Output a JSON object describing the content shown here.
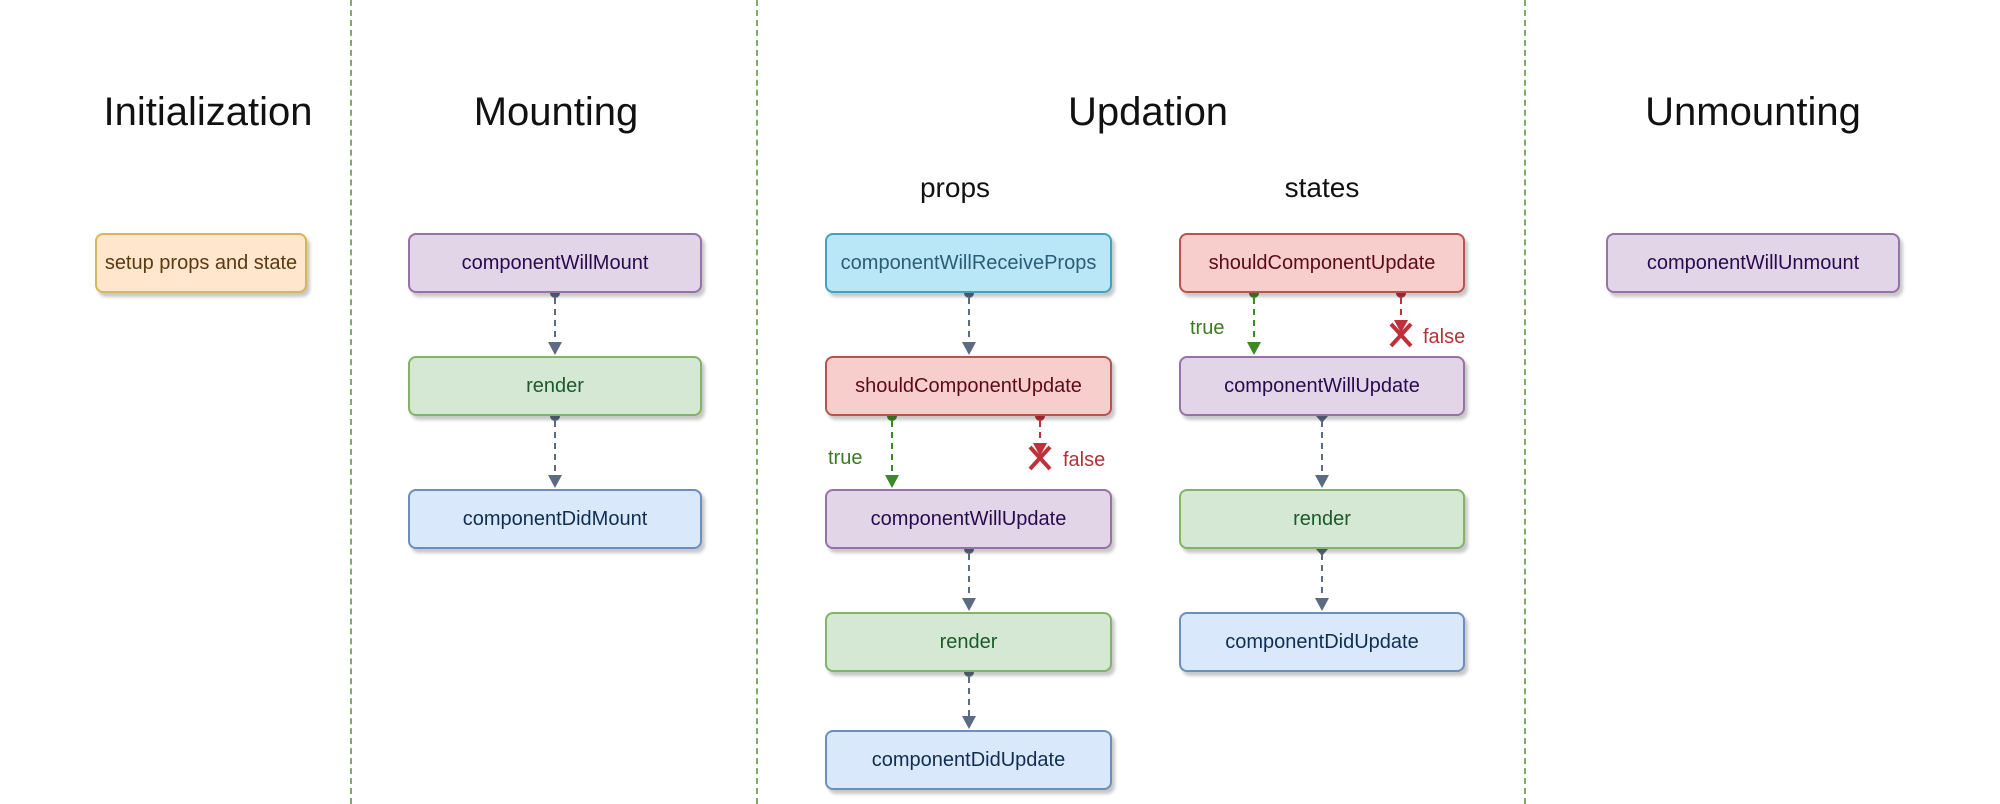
{
  "phases": {
    "initialization": "Initialization",
    "mounting": "Mounting",
    "updation": "Updation",
    "unmounting": "Unmounting"
  },
  "updation_subsections": {
    "props": "props",
    "states": "states"
  },
  "nodes": {
    "init_setup": "setup props and state",
    "mount_will": "componentWillMount",
    "mount_render": "render",
    "mount_did": "componentDidMount",
    "props_receive": "componentWillReceiveProps",
    "props_should": "shouldComponentUpdate",
    "props_will_update": "componentWillUpdate",
    "props_render": "render",
    "props_did_update": "componentDidUpdate",
    "states_should": "shouldComponentUpdate",
    "states_will_update": "componentWillUpdate",
    "states_render": "render",
    "states_did_update": "componentDidUpdate",
    "unmount_will": "componentWillUnmount"
  },
  "branch_labels": {
    "props_true": "true",
    "props_false": "false",
    "states_true": "true",
    "states_false": "false"
  },
  "colors": {
    "separator": "#82a86a",
    "edge_default": "#5d6b82",
    "edge_true": "#3c8a24",
    "edge_false": "#c0303a"
  },
  "edges": [
    {
      "from": "mount_will",
      "to": "mount_render",
      "kind": "default"
    },
    {
      "from": "mount_render",
      "to": "mount_did",
      "kind": "default"
    },
    {
      "from": "props_receive",
      "to": "props_should",
      "kind": "default"
    },
    {
      "from": "props_should",
      "to": "props_will_update",
      "kind": "true"
    },
    {
      "from": "props_should",
      "to": null,
      "kind": "false"
    },
    {
      "from": "props_will_update",
      "to": "props_render",
      "kind": "default"
    },
    {
      "from": "props_render",
      "to": "props_did_update",
      "kind": "default"
    },
    {
      "from": "states_should",
      "to": "states_will_update",
      "kind": "true"
    },
    {
      "from": "states_should",
      "to": null,
      "kind": "false"
    },
    {
      "from": "states_will_update",
      "to": "states_render",
      "kind": "default"
    },
    {
      "from": "states_render",
      "to": "states_did_update",
      "kind": "default"
    }
  ]
}
